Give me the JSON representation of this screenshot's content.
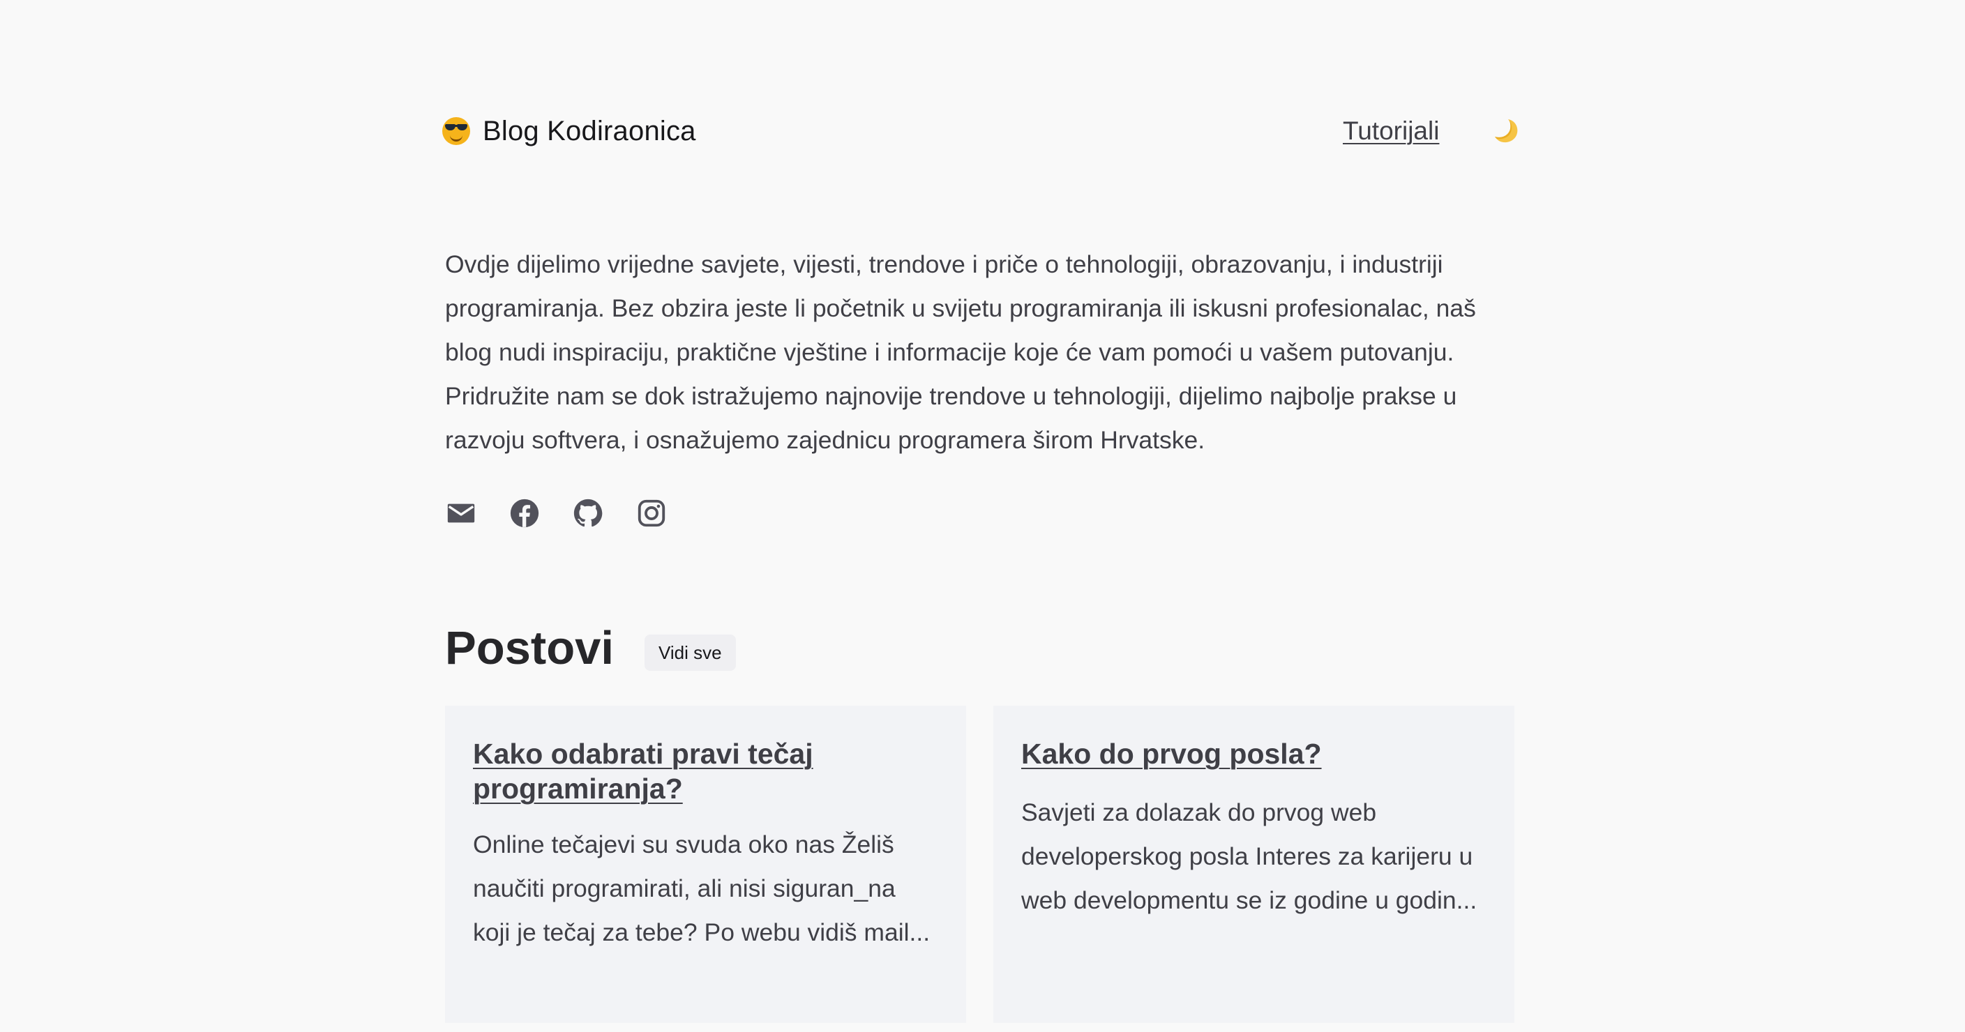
{
  "header": {
    "brand_title": "Blog Kodiraonica",
    "brand_icon": "smiling-face-with-sunglasses-icon",
    "nav_link": "Tutorijali",
    "theme_toggle_icon": "moon-icon"
  },
  "intro": {
    "text": "Ovdje dijelimo vrijedne savjete, vijesti, trendove i priče o tehnologiji, obrazovanju, i industriji programiranja. Bez obzira jeste li početnik u svijetu programiranja ili iskusni profesionalac, naš blog nudi inspiraciju, praktične vještine i informacije koje će vam pomoći u vašem putovanju. Pridružite nam se dok istražujemo najnovije trendove u tehnologiji, dijelimo najbolje prakse u razvoju softvera, i osnažujemo zajednicu programera širom Hrvatske."
  },
  "socials": [
    {
      "icon": "mail-icon"
    },
    {
      "icon": "facebook-icon"
    },
    {
      "icon": "github-icon"
    },
    {
      "icon": "instagram-icon"
    }
  ],
  "posts": {
    "title": "Postovi",
    "see_all": "Vidi sve",
    "items": [
      {
        "title": "Kako odabrati pravi tečaj programiranja?",
        "excerpt": "Online tečajevi su svuda oko nas Želiš naučiti programirati, ali nisi siguran_na koji je tečaj za tebe? Po webu vidiš mail..."
      },
      {
        "title": "Kako do prvog posla?",
        "excerpt": "Savjeti za dolazak do prvog web developerskog posla Interes za karijeru u web developmentu se iz godine u godin..."
      }
    ]
  },
  "colors": {
    "background": "#f9f9f9",
    "card_background": "#f2f3f6",
    "text": "#3f3f46",
    "heading": "#27272a"
  }
}
